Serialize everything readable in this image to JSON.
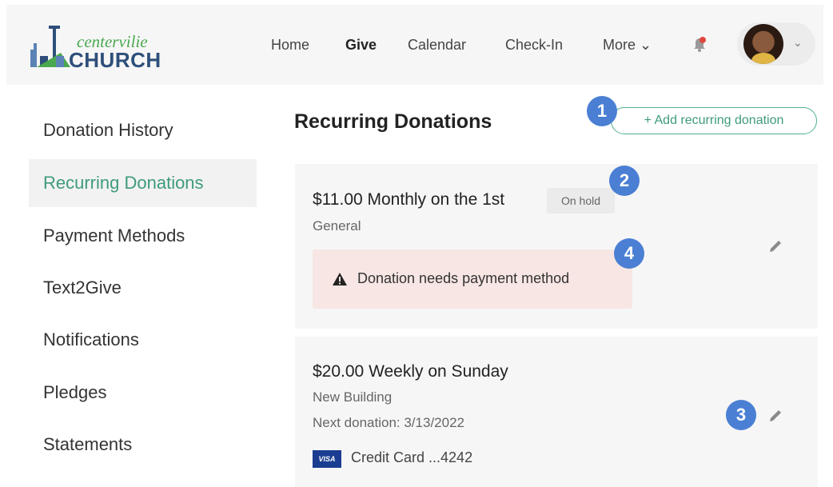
{
  "brand": {
    "name_top": "centervilie",
    "name_bottom": "CHURCH"
  },
  "nav": [
    {
      "label": "Home"
    },
    {
      "label": "Give"
    },
    {
      "label": "Calendar"
    },
    {
      "label": "Check-In"
    },
    {
      "label": "More ⌄"
    }
  ],
  "header": {
    "avatar_caret": "⌄"
  },
  "sidebar": {
    "items": [
      {
        "label": "Donation History"
      },
      {
        "label": "Recurring Donations",
        "active": true
      },
      {
        "label": "Payment Methods"
      },
      {
        "label": "Text2Give"
      },
      {
        "label": "Notifications"
      },
      {
        "label": "Pledges"
      },
      {
        "label": "Statements"
      }
    ]
  },
  "main": {
    "title": "Recurring Donations",
    "add_button_label": "+ Add recurring donation",
    "donations": [
      {
        "amount": "$11.00 Monthly on the 1st",
        "status": "On hold",
        "fund": "General",
        "warning": "Donation needs payment method"
      },
      {
        "amount": "$20.00 Weekly on Sunday",
        "fund": "New Building",
        "next_donation": "Next donation: 3/13/2022",
        "card_brand": "VISA",
        "payment": "Credit Card ...4242"
      }
    ]
  },
  "callouts": [
    "1",
    "2",
    "3",
    "4"
  ],
  "colors": {
    "accent": "#3f9b7b",
    "callout": "#4a7fd4",
    "warning_bg": "#f7e6e3",
    "visa": "#1a3d91"
  },
  "icons": {
    "bell": "bell-icon",
    "edit": "pencil-icon",
    "warning": "warning-triangle-icon"
  }
}
